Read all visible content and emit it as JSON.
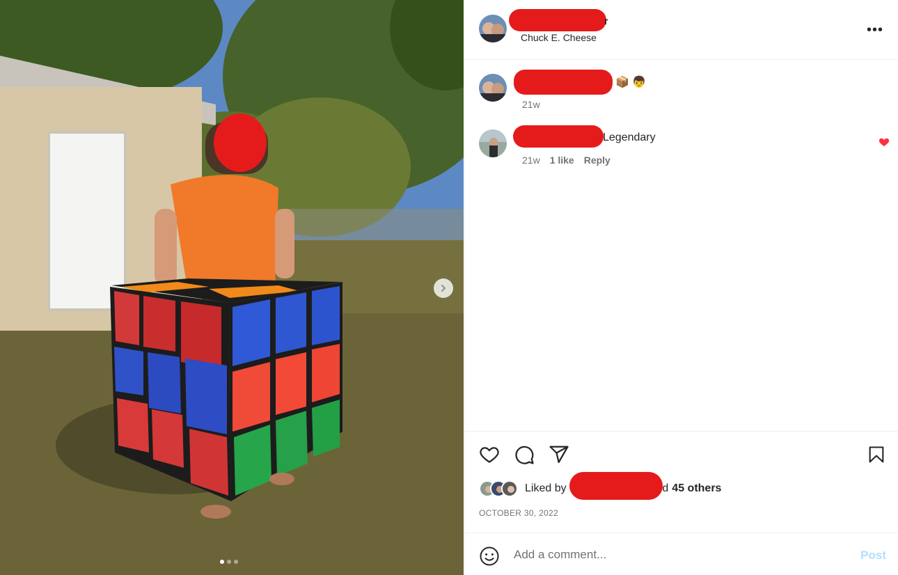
{
  "post": {
    "author_name_tail": "r",
    "location": "Chuck E. Cheese",
    "more_label": "•••"
  },
  "comments": [
    {
      "text": "",
      "emoji": "📦 👦",
      "time": "21w",
      "likes": "",
      "reply": ""
    },
    {
      "text": "Legendary",
      "time": "21w",
      "likes": "1 like",
      "reply": "Reply"
    }
  ],
  "likes": {
    "prefix": "Liked by",
    "suffix_text": "and",
    "others": "45 others"
  },
  "date": "OCTOBER 30, 2022",
  "composer": {
    "placeholder": "Add a comment...",
    "post_label": "Post"
  },
  "colors": {
    "redaction": "#e51b1b",
    "like_red": "#ff3040",
    "post_disabled": "#b2dffc"
  },
  "icons": [
    "heart-icon",
    "comment-icon",
    "share-icon",
    "bookmark-icon",
    "emoji-icon",
    "chevron-right-icon"
  ],
  "carousel": {
    "slide": 1,
    "total": 3
  }
}
